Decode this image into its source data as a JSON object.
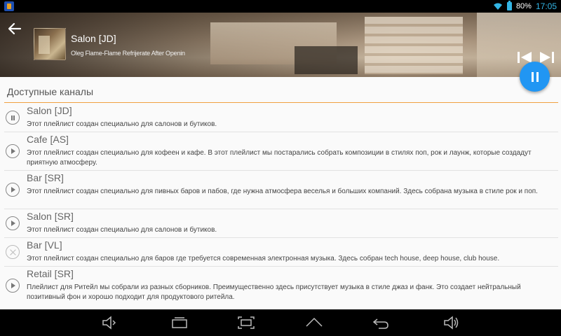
{
  "status_bar": {
    "battery": "80%",
    "time": "17:05"
  },
  "player": {
    "title": "Salon [JD]",
    "subtitle": "Oleg Flame-Flame Refrijerate After Openin"
  },
  "section": {
    "title": "Доступные каналы"
  },
  "channels": [
    {
      "name": "Salon [JD]",
      "status": "playing",
      "description": "Этот плейлист создан специально для салонов и бутиков."
    },
    {
      "name": "Cafe [AS]",
      "status": "stopped",
      "description": "Этот плейлист создан специально для кофеен и кафе. В этот плейлист мы постарались собрать композиции в стилях поп, рок и лаунж, которые создадут приятную атмосферу."
    },
    {
      "name": "Bar [SR]",
      "status": "stopped",
      "description": "Этот плейлист создан специально для пивных баров и пабов, где нужна атмосфера веселья и больших компаний. Здесь собрана музыка в стиле рок и поп."
    },
    {
      "name": "Salon [SR]",
      "status": "stopped",
      "description": "Этот плейлист создан специально для салонов и бутиков."
    },
    {
      "name": "Bar [VL]",
      "status": "unavailable",
      "description": "Этот плейлист создан специально для баров где требуется современная электронная музыка. Здесь собран tech house, deep house, club house."
    },
    {
      "name": "Retail [SR]",
      "status": "stopped",
      "description": "Плейлист для Ритейл мы собрали из разных сборников. Преимущественно здесь присутствует музыка в стиле джаз и фанк. Это создает нейтральный позитивный фон и хорошо подходит для продуктового ритейла."
    }
  ],
  "colors": {
    "accent_line": "#f0a040",
    "fab": "#2196f3",
    "status_time": "#33b5e5"
  },
  "icons": {
    "back": "arrow-left-icon",
    "prev": "skip-previous-icon",
    "next": "skip-next-icon",
    "fab": "pause-icon"
  }
}
